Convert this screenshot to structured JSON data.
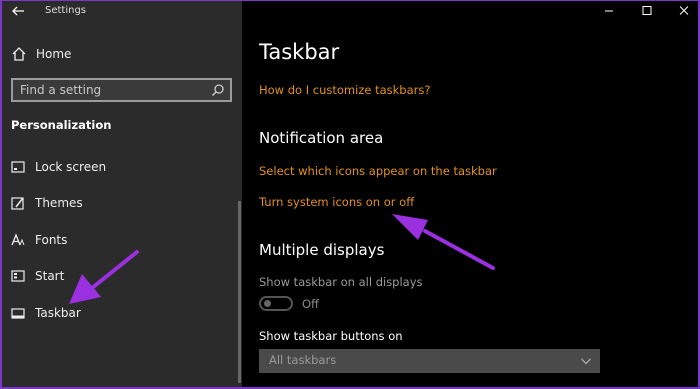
{
  "app": {
    "title": "Settings"
  },
  "sidebar": {
    "home_label": "Home",
    "search_placeholder": "Find a setting",
    "section": "Personalization",
    "items": [
      {
        "label": "Lock screen",
        "icon": "lock-screen-icon"
      },
      {
        "label": "Themes",
        "icon": "themes-icon"
      },
      {
        "label": "Fonts",
        "icon": "fonts-icon"
      },
      {
        "label": "Start",
        "icon": "start-icon"
      },
      {
        "label": "Taskbar",
        "icon": "taskbar-icon"
      }
    ]
  },
  "main": {
    "title": "Taskbar",
    "help_link": "How do I customize taskbars?",
    "notification_heading": "Notification area",
    "link_select_icons": "Select which icons appear on the taskbar",
    "link_system_icons": "Turn system icons on or off",
    "multiple_heading": "Multiple displays",
    "show_all_label": "Show taskbar on all displays",
    "toggle_state": "Off",
    "buttons_on_label": "Show taskbar buttons on",
    "buttons_on_value": "All taskbars"
  },
  "colors": {
    "accent_link": "#e3921d",
    "annotation_arrow": "#9b30e0",
    "sidebar_bg": "#2b2b2b"
  }
}
